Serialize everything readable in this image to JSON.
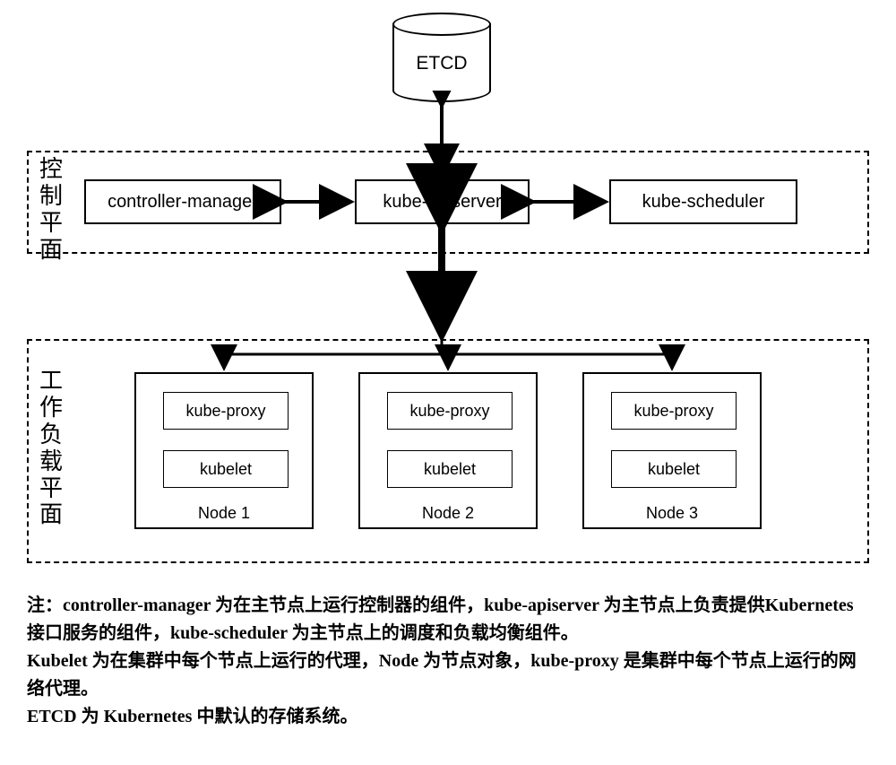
{
  "etcd": {
    "label": "ETCD"
  },
  "control_plane": {
    "label_chars": [
      "控",
      "制",
      "平",
      "面"
    ],
    "controller_manager": "controller-manager",
    "kube_apiserver": "kube-apiserver",
    "kube_scheduler": "kube-scheduler"
  },
  "workload_plane": {
    "label_chars": [
      "工",
      "作",
      "负",
      "载",
      "平",
      "面"
    ],
    "nodes": [
      {
        "kube_proxy": "kube-proxy",
        "kubelet": "kubelet",
        "name": "Node 1"
      },
      {
        "kube_proxy": "kube-proxy",
        "kubelet": "kubelet",
        "name": "Node 2"
      },
      {
        "kube_proxy": "kube-proxy",
        "kubelet": "kubelet",
        "name": "Node 3"
      }
    ]
  },
  "notes": {
    "line1": "注：controller-manager 为在主节点上运行控制器的组件，kube-apiserver 为主节点上负责提供Kubernetes  接口服务的组件，kube-scheduler 为主节点上的调度和负载均衡组件。",
    "line2": "Kubelet 为在集群中每个节点上运行的代理，Node 为节点对象，kube-proxy 是集群中每个节点上运行的网络代理。",
    "line3": "ETCD 为 Kubernetes 中默认的存储系统。"
  }
}
